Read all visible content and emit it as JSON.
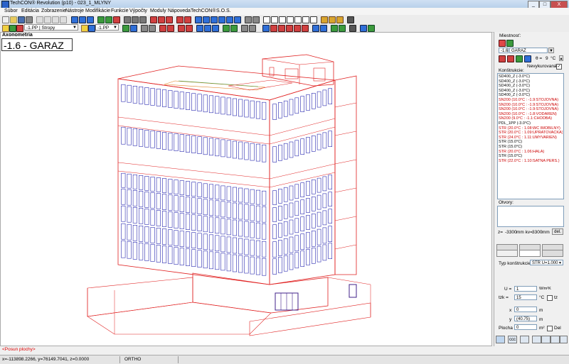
{
  "window": {
    "title": "TechCON® Revolution  (p10) - 023_1_MLYNY",
    "min": "_",
    "max": "□",
    "close": "X"
  },
  "menu": [
    "Súbor",
    "Editácia",
    "Zobrazenie",
    "Nástroje",
    "Modifikácie",
    "Funkcie",
    "Výpočty",
    "Moduly",
    "Nápoveda",
    "TechCON®",
    "S.O.S."
  ],
  "toolbar2": {
    "layer_combo": "-1.PP | Stropy",
    "floor_combo": "-1.PP"
  },
  "view": {
    "name": "Axonometria",
    "floor_label": "-1.6 - GARAZ"
  },
  "command_line": "<Posun plochy>",
  "status": {
    "coords": "x=-113898.2266, y=76149.7041, z=0.0000",
    "ortho": "ORTHO"
  },
  "panel": {
    "room_label": "Miestnosť:",
    "room_number": "-1.6",
    "room_name": "GARAZ",
    "theta_label": "θ =",
    "theta_value": "9",
    "theta_unit": "°C",
    "unheated_label": "Nevykurovaná",
    "unheated_checked": "✓",
    "constructions_label": "Konštrukcie:",
    "constructions": [
      {
        "name": "SD400_Z",
        "detail": "(-3.0°C)",
        "color": "#000000"
      },
      {
        "name": "SD400_Z",
        "detail": "(-3.0°C)",
        "color": "#000000"
      },
      {
        "name": "SD400_Z",
        "detail": "(-3.0°C)",
        "color": "#000000"
      },
      {
        "name": "SD400_Z",
        "detail": "(-3.0°C)",
        "color": "#000000"
      },
      {
        "name": "SD400_Z",
        "detail": "(-3.0°C)",
        "color": "#000000"
      },
      {
        "name": "SN200",
        "detail": "(10.0°C : -1.9:STOJOVNA)",
        "color": "#cc0000"
      },
      {
        "name": "SN200",
        "detail": "(10.0°C : -1.9:STOJOVNA)",
        "color": "#cc0000"
      },
      {
        "name": "SN200",
        "detail": "(10.0°C : -1.9:STOJOVNA)",
        "color": "#cc0000"
      },
      {
        "name": "SN200",
        "detail": "(10.0°C : -1.8:VODAREN)",
        "color": "#cc0000"
      },
      {
        "name": "SN200",
        "detail": "(9.0°C : -1.1:CHODBA)",
        "color": "#cc0000"
      },
      {
        "name": "PDL_1PP",
        "detail": "(-3.0°C)",
        "color": "#000000"
      },
      {
        "name": "STR",
        "detail": "(20.0°C : 1.08:WC IMOBILNY)",
        "color": "#cc0000"
      },
      {
        "name": "STR",
        "detail": "(20.0°C : 1.09:UPRATOVACKA)",
        "color": "#cc0000"
      },
      {
        "name": "STR",
        "detail": "(24.0°C : 1.11:UMYVARIEN)",
        "color": "#cc0000"
      },
      {
        "name": "STR",
        "detail": "(15.0°C)",
        "color": "#000000"
      },
      {
        "name": "STR",
        "detail": "(15.0°C)",
        "color": "#000000"
      },
      {
        "name": "STR",
        "detail": "(20.0°C : 1.06:HALA)",
        "color": "#cc0000"
      },
      {
        "name": "STR",
        "detail": "(15.0°C)",
        "color": "#000000"
      },
      {
        "name": "STR",
        "detail": "(22.0°C : 1.10:SATNA PERS.)",
        "color": "#cc0000"
      }
    ],
    "openings_label": "Otvory:",
    "z_label": "z=",
    "z_value": "-3300",
    "kv_label": "mm  kv=",
    "kv_value": "3300",
    "mm": "mm",
    "del_button": "del.",
    "type_label": "Typ konštrukcie",
    "type_value": "STR U=1.000",
    "u_label": "U =",
    "u_value": "1",
    "u_unit": "W/m²K",
    "tzk_label": "tzk =",
    "tzk_value": "15",
    "tzk_unit": "°C",
    "tz_label": "tz",
    "x_label": "x",
    "x_value": "0",
    "x_unit": "m",
    "y_label": "y",
    "y_value": "(40.75)",
    "y_unit": "m",
    "area_label": "Plocha",
    "area_value": "0",
    "area_unit": "m²",
    "del_label": "Del",
    "bottom_buttons": [
      "ccc"
    ]
  }
}
